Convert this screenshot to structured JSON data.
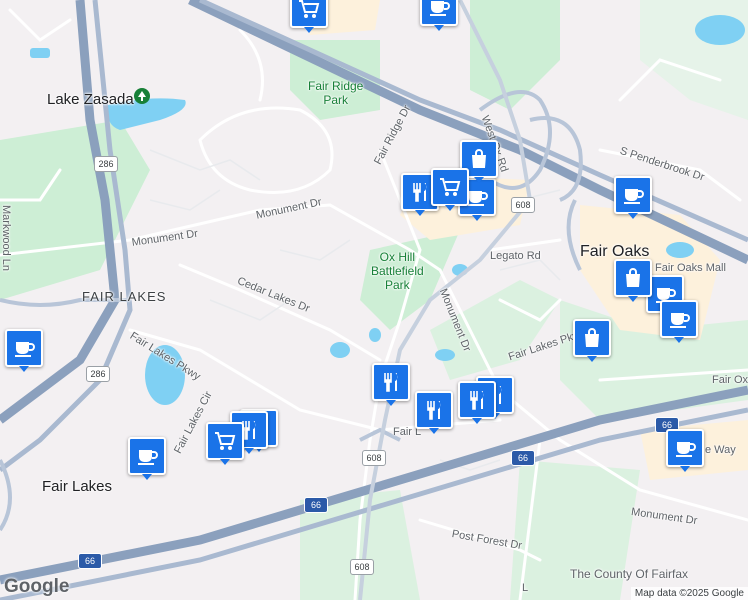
{
  "map": {
    "places": {
      "lake_zasada": "Lake Zasada",
      "fair_ridge_park": [
        "Fair Ridge",
        "Park"
      ],
      "ox_hill_park": [
        "Ox Hill",
        "Battlefield",
        "Park"
      ],
      "fair_oaks": "Fair Oaks",
      "fair_oaks_mall": "Fair Oaks Mall",
      "fair_lakes_area": "FAIR LAKES",
      "fair_lakes_town": "Fair Lakes",
      "county": "The County Of Fairfax"
    },
    "roads": {
      "west_ox_rd": "West Ox Rd",
      "fair_ridge_dr": "Fair Ridge Dr",
      "monument_dr_1": "Monument Dr",
      "monument_dr_2": "Monument Dr",
      "monument_dr_3": "Monument Dr",
      "monument_dr_4": "Monument Dr",
      "cedar_lakes_dr": "Cedar Lakes Dr",
      "fair_lakes_pkwy": "Fair Lakes Pkwy",
      "fair_lakes_pkwy_2": "Fair Lakes Pkw",
      "fair_lakes_cir": "Fair Lakes Cir",
      "markwood_ln": "Markwood Ln",
      "legato_rd": "Legato Rd",
      "s_penderbrook_dr": "S Penderbrook Dr",
      "post_forest_dr": "Post Forest Dr",
      "fair_ox": "Fair Ox",
      "fair_l": "Fair L",
      "e_way": "e Way",
      "l_road": "L"
    },
    "shields": {
      "r286_top": "286",
      "r286_bottom": "286",
      "r608_a": "608",
      "r608_b": "608",
      "r608_c": "608",
      "i66_a": "66",
      "i66_b": "66",
      "i66_c": "66",
      "i66_d": "66"
    },
    "attribution": {
      "logo": "Google",
      "text": "Map data ©2025 Google"
    }
  },
  "poi_icons": {
    "cafe": "coffee-cup-icon",
    "restaurant": "fork-knife-icon",
    "shopping": "shopping-bag-icon",
    "grocery": "shopping-cart-icon"
  },
  "colors": {
    "marker": "#1a73e8",
    "highway": "#8ba0bd",
    "park": "#cdeed5",
    "water": "#7fd0f3",
    "commercial": "#fdf1dc"
  }
}
